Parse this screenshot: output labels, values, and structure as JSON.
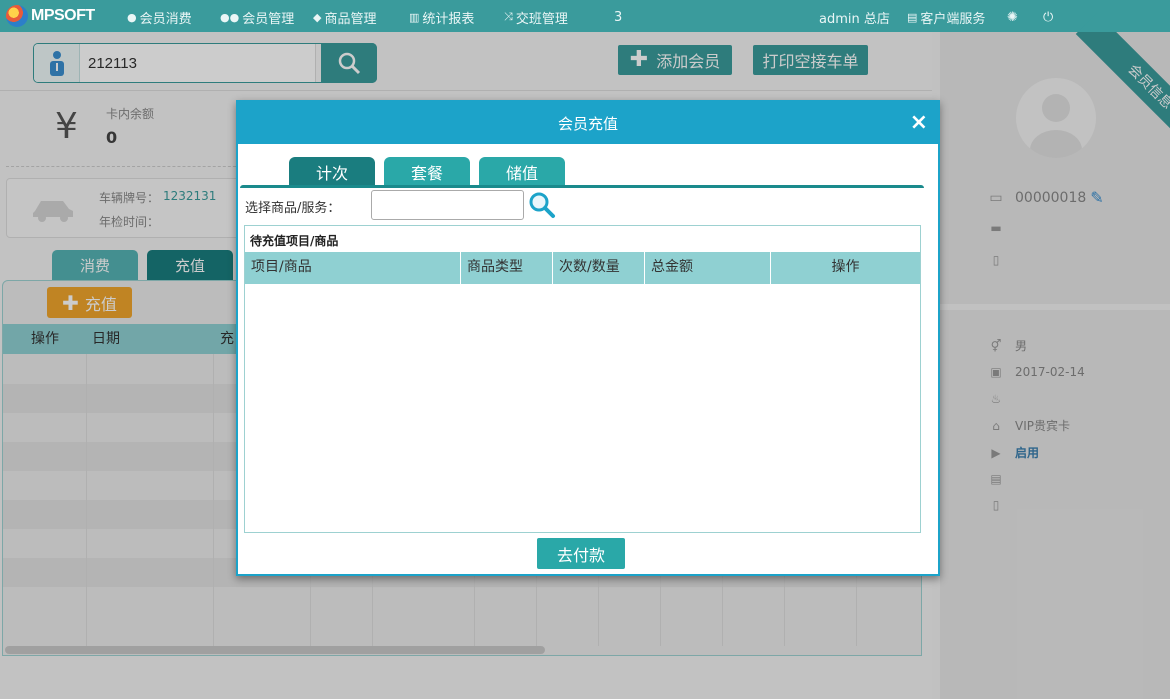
{
  "app": {
    "logo_text": "MPSOFT"
  },
  "nav": {
    "items": [
      {
        "label": "会员消费",
        "icon": "user-circle-icon"
      },
      {
        "label": "会员管理",
        "icon": "users-icon"
      },
      {
        "label": "商品管理",
        "icon": "cubes-icon"
      },
      {
        "label": "统计报表",
        "icon": "bar-chart-icon"
      },
      {
        "label": "交班管理",
        "icon": "shuffle-icon"
      }
    ],
    "badge": "3",
    "user": "admin 总店",
    "client_service": "客户端服务"
  },
  "search": {
    "value": "212113"
  },
  "actions": {
    "add_member": "添加会员",
    "print_handover": "打印空接车单"
  },
  "balance": {
    "symbol": "¥",
    "label": "卡内余额",
    "value": "0"
  },
  "car": {
    "plate_label": "车辆牌号：",
    "plate_value": "1232131",
    "inspection_label": "年检时间："
  },
  "left_tabs": {
    "consume": "消费",
    "recharge": "充值"
  },
  "recharge_button": "充值",
  "grid": {
    "headers": [
      "操作",
      "日期",
      "充"
    ]
  },
  "member_card": {
    "ribbon": "会员信息",
    "card_no": "00000018",
    "gender": "男",
    "date": "2017-02-14",
    "card_type": "VIP贵宾卡",
    "status": "启用"
  },
  "modal": {
    "title": "会员充值",
    "close": "×",
    "tabs": [
      "计次",
      "套餐",
      "储值"
    ],
    "select_label": "选择商品/服务：",
    "pending_title": "待充值项目/商品",
    "columns": [
      "项目/商品",
      "商品类型",
      "次数/数量",
      "总金额",
      "操作"
    ],
    "pay_button": "去付款"
  },
  "colors": {
    "accent": "#3a9b9c",
    "modal_header": "#1ca3c9",
    "orange": "#f0a52c",
    "table_header": "#8fd0d2"
  }
}
